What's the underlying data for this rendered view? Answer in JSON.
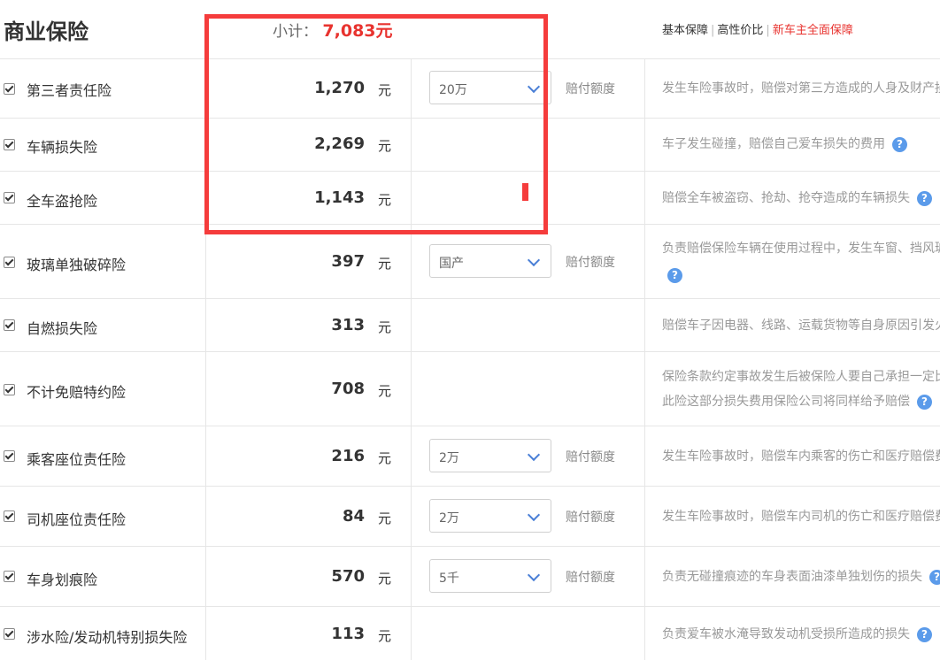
{
  "header": {
    "title": "商业保险",
    "subtotal_label": "小计：",
    "subtotal_value": "7,083元",
    "tabs": [
      {
        "label": "基本保障",
        "active": false
      },
      {
        "label": "高性价比",
        "active": false
      },
      {
        "label": "新车主全面保障",
        "active": true
      }
    ]
  },
  "currency_unit": "元",
  "select_label": "赔付额度",
  "help_icon": "?",
  "rows": [
    {
      "name": "第三者责任险",
      "price": "1,270",
      "select": "20万",
      "desc": "发生车险事故时，赔偿对第三方造成的人身及财产损"
    },
    {
      "name": "车辆损失险",
      "price": "2,269",
      "desc": "车子发生碰撞，赔偿自己爱车损失的费用"
    },
    {
      "name": "全车盗抢险",
      "price": "1,143",
      "desc": "赔偿全车被盗窃、抢劫、抢夺造成的车辆损失"
    },
    {
      "name": "玻璃单独破碎险",
      "price": "397",
      "select": "国产",
      "desc": "负责赔偿保险车辆在使用过程中，发生车窗、挡风玻"
    },
    {
      "name": "自燃损失险",
      "price": "313",
      "desc": "赔偿车子因电器、线路、运载货物等自身原因引发火"
    },
    {
      "name": "不计免赔特约险",
      "price": "708",
      "desc": "保险条款约定事故发生后被保险人要自己承担一定比",
      "desc2": "此险这部分损失费用保险公司将同样给予赔偿"
    },
    {
      "name": "乘客座位责任险",
      "price": "216",
      "select": "2万",
      "desc": "发生车险事故时，赔偿车内乘客的伤亡和医疗赔偿费"
    },
    {
      "name": "司机座位责任险",
      "price": "84",
      "select": "2万",
      "desc": "发生车险事故时，赔偿车内司机的伤亡和医疗赔偿费"
    },
    {
      "name": "车身划痕险",
      "price": "570",
      "select": "5千",
      "desc": "负责无碰撞痕迹的车身表面油漆单独划伤的损失"
    },
    {
      "name": "涉水险/发动机特别损失险",
      "price": "113",
      "desc": "负责爱车被水淹导致发动机受损所造成的损失"
    }
  ],
  "colors": {
    "accent": "#e8332f",
    "highlight": "#f53c3c",
    "help": "#5b9bea"
  }
}
